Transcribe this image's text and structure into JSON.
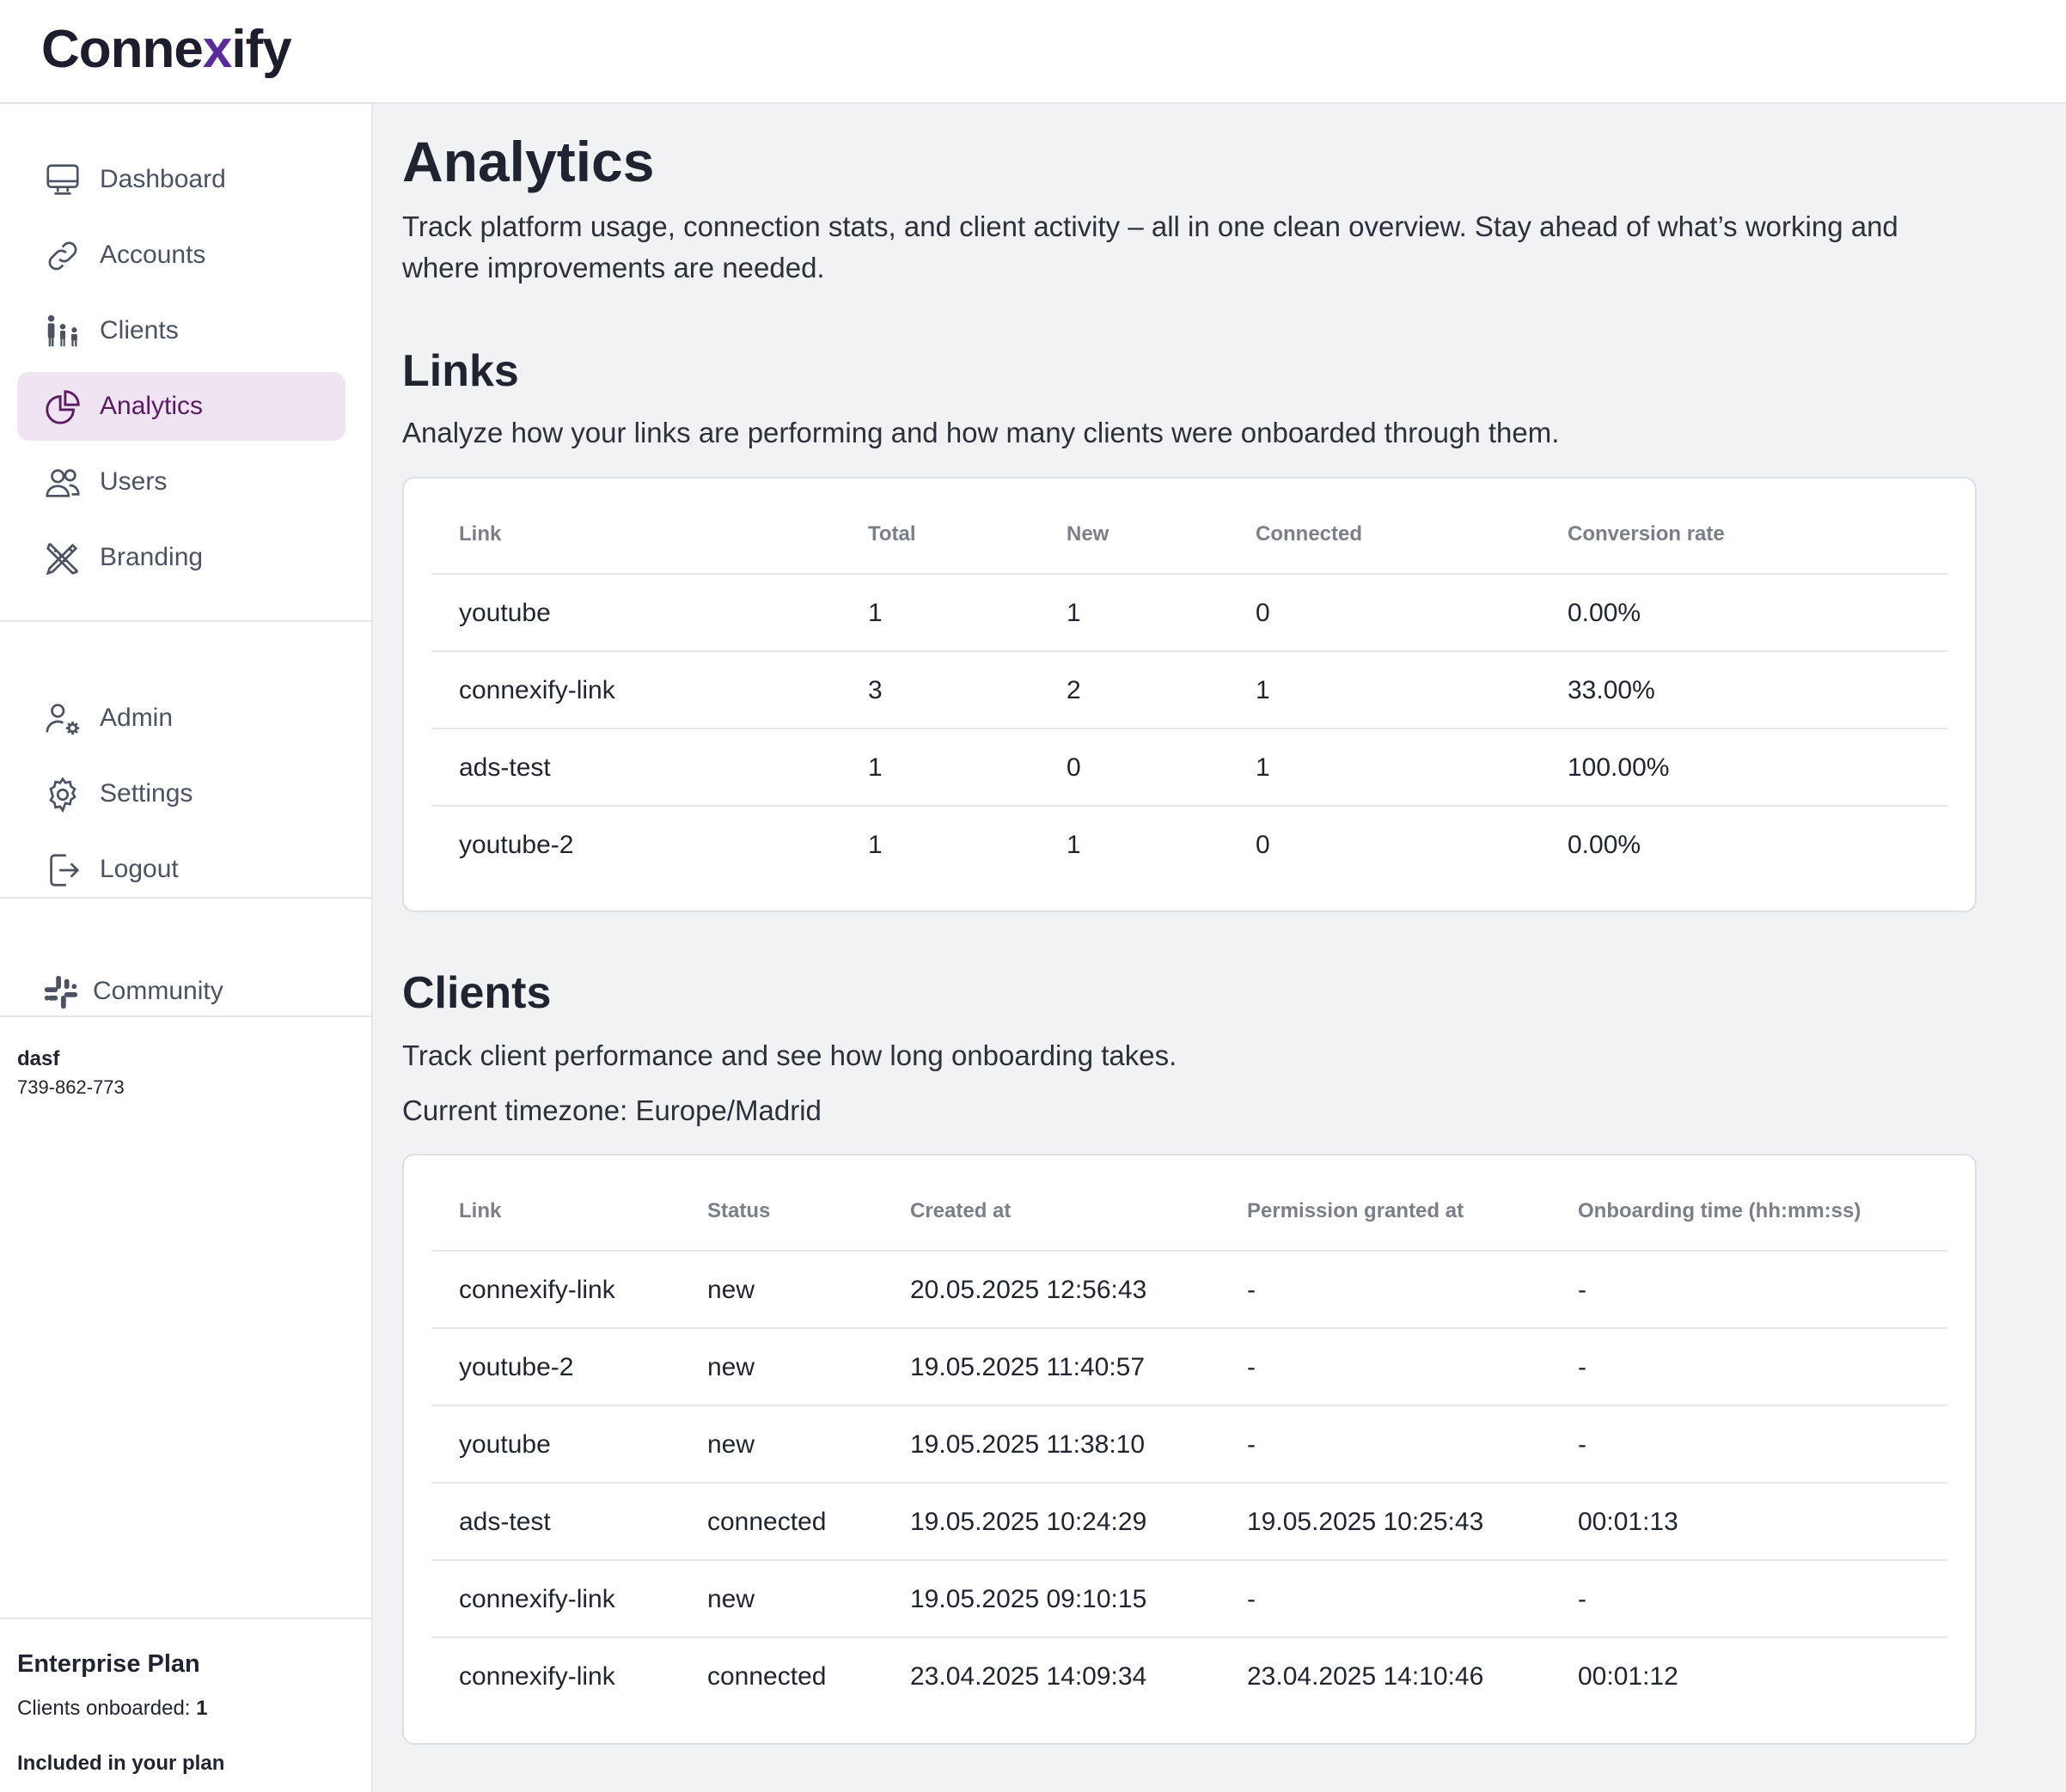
{
  "brand": {
    "logo_a": "Conne",
    "logo_x": "x",
    "logo_b": "ify"
  },
  "sidebar": {
    "nav": [
      {
        "label": "Dashboard",
        "icon": "monitor-icon"
      },
      {
        "label": "Accounts",
        "icon": "link-icon"
      },
      {
        "label": "Clients",
        "icon": "people-icon"
      },
      {
        "label": "Analytics",
        "icon": "pie-chart-icon",
        "active": true
      },
      {
        "label": "Users",
        "icon": "users-icon"
      },
      {
        "label": "Branding",
        "icon": "pencil-ruler-icon"
      }
    ],
    "secondary": [
      {
        "label": "Admin",
        "icon": "user-gear-icon"
      },
      {
        "label": "Settings",
        "icon": "gear-icon"
      },
      {
        "label": "Logout",
        "icon": "logout-icon"
      }
    ],
    "community": {
      "label": "Community",
      "icon": "slack-icon"
    },
    "user": {
      "name": "dasf",
      "id": "739-862-773"
    },
    "plan": {
      "title": "Enterprise Plan",
      "clients_label": "Clients onboarded: ",
      "clients_value": "1",
      "included": "Included in your plan"
    }
  },
  "main": {
    "title": "Analytics",
    "description": "Track platform usage, connection stats, and client activity – all in one clean overview. Stay ahead of what’s working and where improvements are needed.",
    "links": {
      "title": "Links",
      "description": "Analyze how your links are performing and how many clients were onboarded through them.",
      "columns": [
        "Link",
        "Total",
        "New",
        "Connected",
        "Conversion rate"
      ],
      "rows": [
        [
          "youtube",
          "1",
          "1",
          "0",
          "0.00%"
        ],
        [
          "connexify-link",
          "3",
          "2",
          "1",
          "33.00%"
        ],
        [
          "ads-test",
          "1",
          "0",
          "1",
          "100.00%"
        ],
        [
          "youtube-2",
          "1",
          "1",
          "0",
          "0.00%"
        ]
      ]
    },
    "clients": {
      "title": "Clients",
      "description": "Track client performance and see how long onboarding takes.",
      "timezone": "Current timezone: Europe/Madrid",
      "columns": [
        "Link",
        "Status",
        "Created at",
        "Permission granted at",
        "Onboarding time (hh:mm:ss)"
      ],
      "rows": [
        [
          "connexify-link",
          "new",
          "20.05.2025 12:56:43",
          "-",
          "-"
        ],
        [
          "youtube-2",
          "new",
          "19.05.2025 11:40:57",
          "-",
          "-"
        ],
        [
          "youtube",
          "new",
          "19.05.2025 11:38:10",
          "-",
          "-"
        ],
        [
          "ads-test",
          "connected",
          "19.05.2025 10:24:29",
          "19.05.2025 10:25:43",
          "00:01:13"
        ],
        [
          "connexify-link",
          "new",
          "19.05.2025 09:10:15",
          "-",
          "-"
        ],
        [
          "connexify-link",
          "connected",
          "23.04.2025 14:09:34",
          "23.04.2025 14:10:46",
          "00:01:12"
        ]
      ]
    }
  }
}
